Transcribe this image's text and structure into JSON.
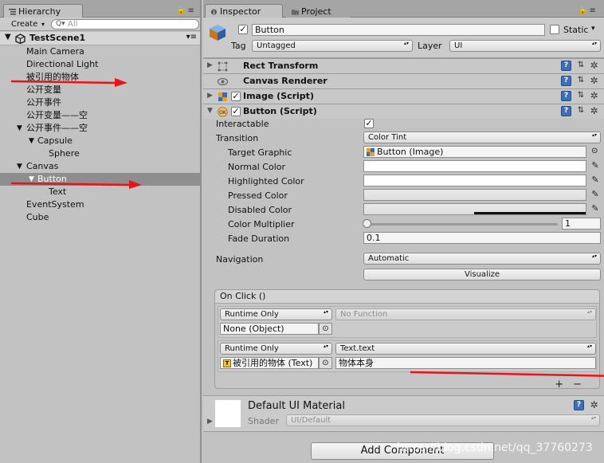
{
  "hierarchy": {
    "tab_label": "Hierarchy",
    "create_label": "Create",
    "search_placeholder": "All",
    "search_prefix": "Q▾",
    "scene_name": "TestScene1",
    "items": [
      {
        "label": "Main Camera"
      },
      {
        "label": "Directional Light"
      },
      {
        "label": "被引用的物体"
      },
      {
        "label": "公开变量"
      },
      {
        "label": "公开事件"
      },
      {
        "label": "公开变量——空"
      },
      {
        "label": "公开事件——空"
      },
      {
        "label": "Capsule"
      },
      {
        "label": "Sphere"
      },
      {
        "label": "Canvas"
      },
      {
        "label": "Button"
      },
      {
        "label": "Text"
      },
      {
        "label": "EventSystem"
      },
      {
        "label": "Cube"
      }
    ]
  },
  "inspector": {
    "tab_label": "Inspector",
    "project_tab_label": "Project",
    "object_name": "Button",
    "static_label": "Static",
    "tag_label": "Tag",
    "tag_value": "Untagged",
    "layer_label": "Layer",
    "layer_value": "UI",
    "components": {
      "rect_transform": "Rect Transform",
      "canvas_renderer": "Canvas Renderer",
      "image_script": "Image (Script)",
      "button_script": "Button (Script)"
    },
    "button": {
      "interactable_label": "Interactable",
      "transition_label": "Transition",
      "transition_value": "Color Tint",
      "target_graphic_label": "Target Graphic",
      "target_graphic_value": "Button (Image)",
      "normal_color_label": "Normal Color",
      "highlighted_color_label": "Highlighted Color",
      "pressed_color_label": "Pressed Color",
      "disabled_color_label": "Disabled Color",
      "color_multiplier_label": "Color Multiplier",
      "color_multiplier_value": "1",
      "fade_duration_label": "Fade Duration",
      "fade_duration_value": "0.1",
      "navigation_label": "Navigation",
      "navigation_value": "Automatic",
      "visualize_label": "Visualize"
    },
    "on_click": {
      "header": "On Click ()",
      "entry1": {
        "mode": "Runtime Only",
        "function": "No Function",
        "object": "None (Object)"
      },
      "entry2": {
        "mode": "Runtime Only",
        "function": "Text.text",
        "object": "被引用的物体 (Text)",
        "argument": "物体本身"
      },
      "plus": "+",
      "minus": "−"
    },
    "material": {
      "name": "Default UI Material",
      "shader_label": "Shader",
      "shader_value": "UI/Default"
    },
    "add_component_label": "Add Component"
  },
  "watermark": "https://blog.csdn.net/qq_37760273",
  "colors": {
    "selection": "#8e8e8e",
    "annotation_red": "#e8141b",
    "help_blue": "#3f6fb5"
  }
}
